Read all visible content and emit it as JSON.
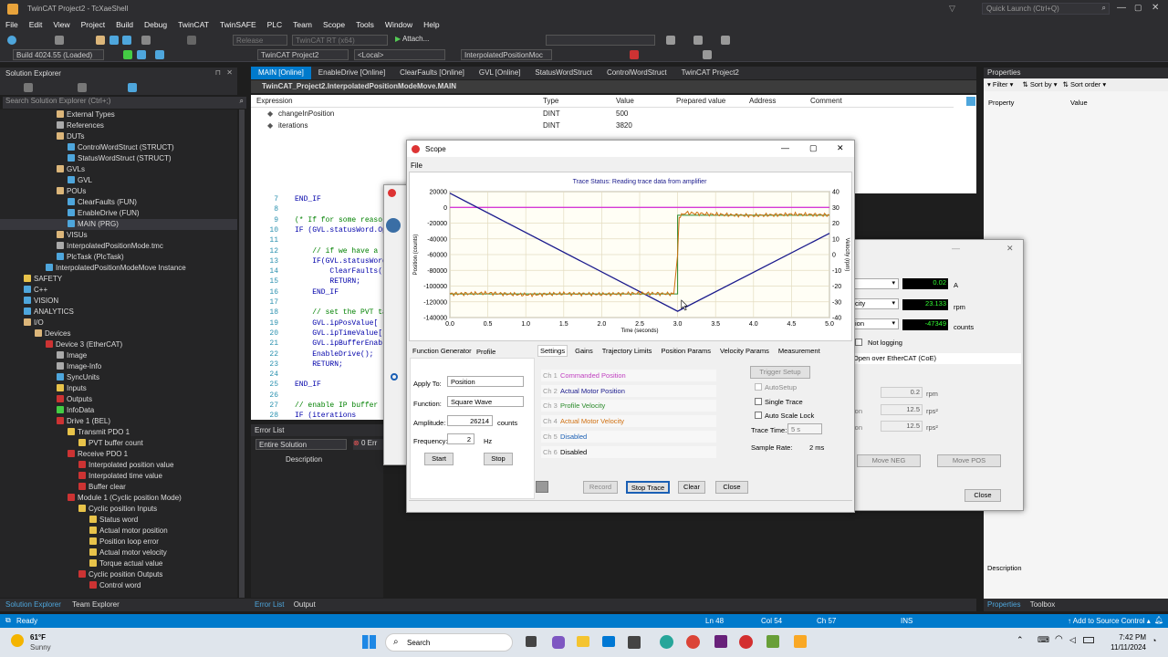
{
  "app": {
    "title": "TwinCAT Project2 - TcXaeShell",
    "quick_launch": "Quick Launch (Ctrl+Q)"
  },
  "menu": [
    "File",
    "Edit",
    "View",
    "Project",
    "Build",
    "Debug",
    "TwinCAT",
    "TwinSAFE",
    "PLC",
    "Team",
    "Scope",
    "Tools",
    "Window",
    "Help"
  ],
  "toolbar": {
    "config": "Release",
    "target": "TwinCAT RT (x64)",
    "attach": "Attach...",
    "build": "Build 4024.55 (Loaded)",
    "project": "TwinCAT Project2",
    "local": "<Local>",
    "plc": "InterpolatedPositionMoc"
  },
  "solution_explorer": {
    "title": "Solution Explorer",
    "search": "Search Solution Explorer (Ctrl+;)",
    "items": [
      {
        "label": "External Types",
        "indent": 6,
        "color": "#dcb67a"
      },
      {
        "label": "References",
        "indent": 6,
        "color": "#aaa"
      },
      {
        "label": "DUTs",
        "indent": 6,
        "color": "#dcb67a"
      },
      {
        "label": "ControlWordStruct (STRUCT)",
        "indent": 7,
        "color": "#4ea6dc"
      },
      {
        "label": "StatusWordStruct (STRUCT)",
        "indent": 7,
        "color": "#4ea6dc"
      },
      {
        "label": "GVLs",
        "indent": 6,
        "color": "#dcb67a"
      },
      {
        "label": "GVL",
        "indent": 7,
        "color": "#4ea6dc"
      },
      {
        "label": "POUs",
        "indent": 6,
        "color": "#dcb67a"
      },
      {
        "label": "ClearFaults (FUN)",
        "indent": 7,
        "color": "#4ea6dc"
      },
      {
        "label": "EnableDrive (FUN)",
        "indent": 7,
        "color": "#4ea6dc"
      },
      {
        "label": "MAIN (PRG)",
        "indent": 7,
        "color": "#4ea6dc",
        "selected": true
      },
      {
        "label": "VISUs",
        "indent": 6,
        "color": "#dcb67a"
      },
      {
        "label": "InterpolatedPositionMode.tmc",
        "indent": 6,
        "color": "#aaa"
      },
      {
        "label": "PlcTask (PlcTask)",
        "indent": 6,
        "color": "#4ea6dc"
      },
      {
        "label": "InterpolatedPositionModeMove Instance",
        "indent": 5,
        "color": "#4ea6dc"
      },
      {
        "label": "SAFETY",
        "indent": 3,
        "color": "#e8c34a"
      },
      {
        "label": "C++",
        "indent": 3,
        "color": "#4ea6dc"
      },
      {
        "label": "VISION",
        "indent": 3,
        "color": "#4ea6dc"
      },
      {
        "label": "ANALYTICS",
        "indent": 3,
        "color": "#4ea6dc"
      },
      {
        "label": "I/O",
        "indent": 3,
        "color": "#dcb67a"
      },
      {
        "label": "Devices",
        "indent": 4,
        "color": "#dcb67a"
      },
      {
        "label": "Device 3 (EtherCAT)",
        "indent": 5,
        "color": "#c33"
      },
      {
        "label": "Image",
        "indent": 6,
        "color": "#aaa"
      },
      {
        "label": "Image-Info",
        "indent": 6,
        "color": "#aaa"
      },
      {
        "label": "SyncUnits",
        "indent": 6,
        "color": "#4ea6dc"
      },
      {
        "label": "Inputs",
        "indent": 6,
        "color": "#e8c34a"
      },
      {
        "label": "Outputs",
        "indent": 6,
        "color": "#c33"
      },
      {
        "label": "InfoData",
        "indent": 6,
        "color": "#4c4"
      },
      {
        "label": "Drive 1 (BEL)",
        "indent": 6,
        "color": "#c33"
      },
      {
        "label": "Transmit PDO 1",
        "indent": 7,
        "color": "#e8c34a"
      },
      {
        "label": "PVT buffer count",
        "indent": 8,
        "color": "#e8c34a"
      },
      {
        "label": "Receive PDO 1",
        "indent": 7,
        "color": "#c33"
      },
      {
        "label": "Interpolated position value",
        "indent": 8,
        "color": "#c33"
      },
      {
        "label": "Interpolated time value",
        "indent": 8,
        "color": "#c33"
      },
      {
        "label": "Buffer clear",
        "indent": 8,
        "color": "#c33"
      },
      {
        "label": "Module 1 (Cyclic position Mode)",
        "indent": 7,
        "color": "#c33"
      },
      {
        "label": "Cyclic position Inputs",
        "indent": 8,
        "color": "#e8c34a"
      },
      {
        "label": "Status word",
        "indent": 9,
        "color": "#e8c34a"
      },
      {
        "label": "Actual motor position",
        "indent": 9,
        "color": "#e8c34a"
      },
      {
        "label": "Position loop error",
        "indent": 9,
        "color": "#e8c34a"
      },
      {
        "label": "Actual motor velocity",
        "indent": 9,
        "color": "#e8c34a"
      },
      {
        "label": "Torque actual value",
        "indent": 9,
        "color": "#e8c34a"
      },
      {
        "label": "Cyclic position Outputs",
        "indent": 8,
        "color": "#c33"
      },
      {
        "label": "Control word",
        "indent": 9,
        "color": "#c33"
      }
    ],
    "bottom_tabs": [
      "Solution Explorer",
      "Team Explorer"
    ]
  },
  "doc_tabs": [
    "MAIN [Online]",
    "EnableDrive [Online]",
    "ClearFaults [Online]",
    "GVL [Online]",
    "StatusWordStruct",
    "ControlWordStruct",
    "TwinCAT Project2"
  ],
  "editor_path": "TwinCAT_Project2.InterpolatedPositionModeMove.MAIN",
  "watch": {
    "headers": [
      "Expression",
      "Type",
      "Value",
      "Prepared value",
      "Address",
      "Comment"
    ],
    "rows": [
      {
        "expr": "changeInPosition",
        "type": "DINT",
        "value": "500"
      },
      {
        "expr": "iterations",
        "type": "DINT",
        "value": "3820"
      }
    ]
  },
  "code": {
    "lines": [
      {
        "n": "7",
        "t": "END_IF"
      },
      {
        "n": "8",
        "t": ""
      },
      {
        "n": "9",
        "t": "(* If for some reaso"
      },
      {
        "n": "10",
        "t": "IF (GVL.statusWord.Op"
      },
      {
        "n": "11",
        "t": ""
      },
      {
        "n": "12",
        "t": "    // if we have a"
      },
      {
        "n": "13",
        "t": "    IF(GVL.statusWord"
      },
      {
        "n": "14",
        "t": "        ClearFaults()"
      },
      {
        "n": "15",
        "t": "        RETURN;"
      },
      {
        "n": "16",
        "t": "    END_IF"
      },
      {
        "n": "17",
        "t": ""
      },
      {
        "n": "18",
        "t": "    // set the PVT ta"
      },
      {
        "n": "19",
        "t": "    GVL.ipPosValue["
      },
      {
        "n": "20",
        "t": "    GVL.ipTimeValue["
      },
      {
        "n": "21",
        "t": "    GVL.ipBufferEnabl"
      },
      {
        "n": "22",
        "t": "    EnableDrive();"
      },
      {
        "n": "23",
        "t": "    RETURN;"
      },
      {
        "n": "24",
        "t": ""
      },
      {
        "n": "25",
        "t": "END_IF"
      },
      {
        "n": "26",
        "t": ""
      },
      {
        "n": "27",
        "t": "// enable IP buffer"
      },
      {
        "n": "28",
        "t": "IF (iterations"
      }
    ]
  },
  "error_list": {
    "title": "Error List",
    "scope": "Entire Solution",
    "errors": "0 Err",
    "col_desc": "Description",
    "bottom_tabs": [
      "Error List",
      "Output"
    ]
  },
  "properties": {
    "title": "Properties",
    "filter": "Filter",
    "sortby": "Sort by",
    "sortorder": "Sort order",
    "col_prop": "Property",
    "col_val": "Value",
    "desc": "Description",
    "bottom_tabs": [
      "Properties",
      "Toolbox"
    ]
  },
  "back_dialog": {
    "readouts": [
      {
        "value": "0.02",
        "unit": "A"
      },
      {
        "value": "23.133",
        "unit": "rpm"
      },
      {
        "value": "-47349",
        "unit": "counts"
      }
    ],
    "labels": [
      "city",
      "ion"
    ],
    "not_logging": "Not logging",
    "coe": "Open over EtherCAT (CoE)",
    "params": [
      {
        "value": "0.2",
        "unit": "rpm",
        "label": ""
      },
      {
        "value": "12.5",
        "unit": "rps²",
        "label": "ion"
      },
      {
        "value": "12.5",
        "unit": "rps²",
        "label": "ion"
      }
    ],
    "move_neg": "Move NEG",
    "move_pos": "Move POS",
    "close": "Close"
  },
  "scope": {
    "title": "Scope",
    "menu": "File",
    "trace_status": "Trace Status:  Reading trace data from amplifier",
    "left_tabs": [
      "Function Generator",
      "Profile"
    ],
    "apply_to_label": "Apply To:",
    "apply_to": "Position",
    "function_label": "Function:",
    "function": "Square Wave",
    "amplitude_label": "Amplitude:",
    "amplitude": "26214",
    "amplitude_unit": "counts",
    "frequency_label": "Frequency:",
    "frequency": "2",
    "frequency_unit": "Hz",
    "start": "Start",
    "stop": "Stop",
    "right_tabs": [
      "Settings",
      "Gains",
      "Trajectory Limits",
      "Position Params",
      "Velocity Params",
      "Measurement"
    ],
    "channels": [
      {
        "ch": "Ch 1",
        "name": "Commanded Position",
        "color": "#c040c0"
      },
      {
        "ch": "Ch 2",
        "name": "Actual Motor Position",
        "color": "#1a1a8c"
      },
      {
        "ch": "Ch 3",
        "name": "Profile Velocity",
        "color": "#2a8a2a"
      },
      {
        "ch": "Ch 4",
        "name": "Actual Motor Velocity",
        "color": "#d07010"
      },
      {
        "ch": "Ch 5",
        "name": "Disabled",
        "color": "#1a5fb4"
      },
      {
        "ch": "Ch 6",
        "name": "Disabled",
        "color": "#000000"
      }
    ],
    "trigger_setup": "Trigger Setup",
    "autosetup": "AutoSetup",
    "single_trace": "Single Trace",
    "auto_scale": "Auto Scale Lock",
    "trace_time_label": "Trace Time:",
    "trace_time": "5 s",
    "sample_rate_label": "Sample Rate:",
    "sample_rate": "2 ms",
    "record": "Record",
    "stop_trace": "Stop Trace",
    "clear": "Clear",
    "close": "Close"
  },
  "chart_data": {
    "type": "line",
    "title": "Trace Status:  Reading trace data from amplifier",
    "xlabel": "Time (seconds)",
    "ylabel": "Position (counts)",
    "ylabel2": "Velocity (rpm)",
    "xlim": [
      0,
      5
    ],
    "ylim": [
      -140000,
      20000
    ],
    "ylim2": [
      -40,
      40
    ],
    "x_ticks": [
      "0.0",
      "0.5",
      "1.0",
      "1.5",
      "2.0",
      "2.5",
      "3.0",
      "3.5",
      "4.0",
      "4.5",
      "5.0"
    ],
    "y_ticks": [
      "20000",
      "0",
      "-20000",
      "-40000",
      "-60000",
      "-80000",
      "-100000",
      "-120000",
      "-140000"
    ],
    "y2_ticks": [
      "40",
      "30",
      "20",
      "10",
      "0",
      "-10",
      "-20",
      "-30",
      "-40"
    ],
    "grid": true,
    "series": [
      {
        "name": "Commanded Position",
        "axis": "left",
        "x": [
          0,
          5
        ],
        "y": [
          0,
          0
        ]
      },
      {
        "name": "Actual Motor Position",
        "axis": "left",
        "x": [
          0,
          3,
          5
        ],
        "y": [
          18000,
          -132000,
          -33000
        ]
      },
      {
        "name": "Profile Velocity",
        "axis": "right",
        "x": [
          0,
          3,
          3,
          5
        ],
        "y": [
          -25,
          -25,
          25,
          25
        ]
      },
      {
        "name": "Actual Motor Velocity",
        "axis": "right",
        "x": [
          0,
          0.5,
          1,
          1.5,
          2,
          2.5,
          2.95,
          3.0,
          3.02,
          3.1,
          3.5,
          4,
          4.5,
          5
        ],
        "y": [
          -25,
          -24.5,
          -25.5,
          -24.8,
          -25.2,
          -24.6,
          -25,
          0,
          24,
          26.5,
          25.5,
          24.8,
          25.6,
          25.2
        ]
      }
    ]
  },
  "status": {
    "ready": "Ready",
    "ln": "Ln 48",
    "col": "Col 54",
    "ch": "Ch 57",
    "ins": "INS",
    "source": "Add to Source Control"
  },
  "taskbar": {
    "temp": "61°F",
    "weather": "Sunny",
    "search": "Search",
    "time": "7:42 PM",
    "date": "11/11/2024"
  }
}
